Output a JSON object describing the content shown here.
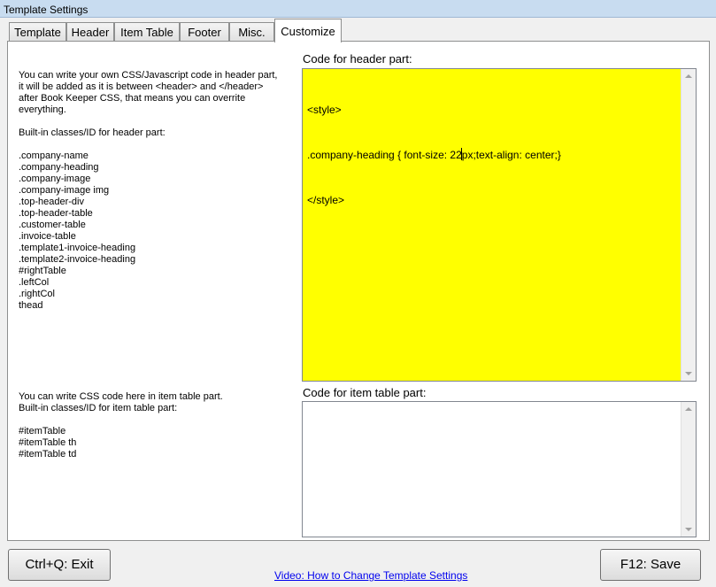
{
  "window": {
    "title": "Template Settings"
  },
  "tabs": [
    {
      "label": "Template"
    },
    {
      "label": "Header"
    },
    {
      "label": "Item Table"
    },
    {
      "label": "Footer"
    },
    {
      "label": "Misc."
    },
    {
      "label": "Customize"
    }
  ],
  "header_section": {
    "help_text": "You can write your own CSS/Javascript code in header part,\nit will be added as it is between <header> and </header>\nafter Book Keeper CSS, that means you can overrite\neverything.\n\nBuilt-in classes/ID for header part:\n\n.company-name\n.company-heading\n.company-image\n.company-image img\n.top-header-div\n.top-header-table\n.customer-table\n.invoice-table\n.template1-invoice-heading\n.template2-invoice-heading\n#rightTable\n.leftCol\n.rightCol\nthead",
    "code_label": "Code for header part:",
    "code_line1": "<style>",
    "code_line2_before_caret": ".company-heading { font-size: 22",
    "code_line2_after_caret": "px;text-align: center;}",
    "code_line3": "</style>",
    "code_bg": "#ffff00"
  },
  "item_section": {
    "help_text": "You can write CSS code here in item table part.\nBuilt-in classes/ID for item table part:\n\n#itemTable\n#itemTable th\n#itemTable td",
    "code_label": "Code for item table part:",
    "code_value": ""
  },
  "footer": {
    "exit_label": "Ctrl+Q: Exit",
    "video_link": "Video: How to Change Template Settings",
    "save_label": "F12: Save"
  }
}
